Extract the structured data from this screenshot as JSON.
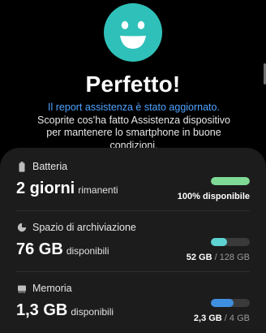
{
  "header": {
    "headline": "Perfetto!",
    "link_text": "Il report assistenza è stato aggiornato.",
    "body_text": " Scoprite cos'ha fatto Assistenza dispositivo per mantenere lo smartphone in buone condizioni."
  },
  "colors": {
    "smiley": "#2fc1b9",
    "link": "#4da3ff",
    "battery_bar": "#7ed995",
    "storage_bar": "#5fd3d3",
    "memory_bar": "#3f8fe0"
  },
  "battery": {
    "icon": "battery-icon",
    "label": "Batteria",
    "value": "2 giorni",
    "unit": "rimanenti",
    "bar_fraction": 1.0,
    "caption": "100% disponibile"
  },
  "storage": {
    "icon": "storage-pie-icon",
    "label": "Spazio di archiviazione",
    "value": "76 GB",
    "unit": "disponibili",
    "bar_fraction": 0.40625,
    "caption_used": "52 GB",
    "caption_sep": " / ",
    "caption_total": "128 GB"
  },
  "memory": {
    "icon": "memory-chip-icon",
    "label": "Memoria",
    "value": "1,3 GB",
    "unit": "disponibili",
    "bar_fraction": 0.575,
    "caption_used": "2,3 GB",
    "caption_sep": " / ",
    "caption_total": "4 GB"
  }
}
